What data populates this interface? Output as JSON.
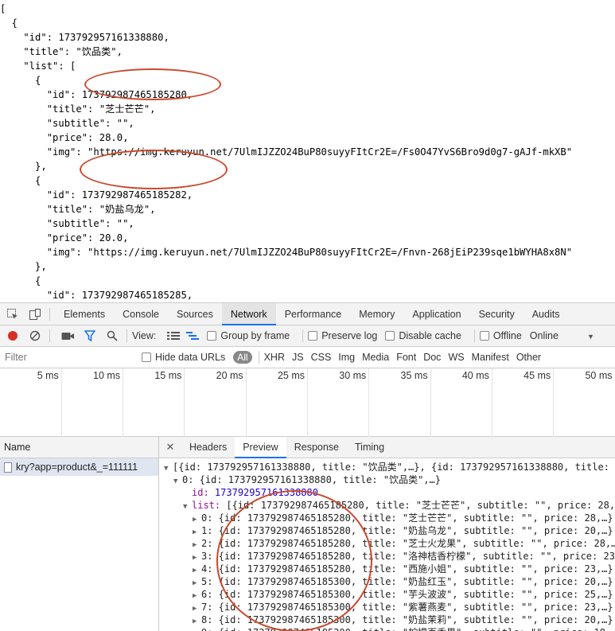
{
  "raw_json_lines": [
    "[",
    "  {",
    "    \"id\": 173792957161338880,",
    "    \"title\": \"饮品类\",",
    "    \"list\": [",
    "      {",
    "        \"id\": 173792987465185280,",
    "        \"title\": \"芝士芒芒\",",
    "        \"subtitle\": \"\",",
    "        \"price\": 28.0,",
    "        \"img\": \"https://img.keruyun.net/7UlmIJZZO24BuP80suyyFItCr2E=/Fs0O47YvS6Bro9d0g7-gAJf-mkXB\"",
    "      },",
    "      {",
    "        \"id\": 173792987465185282,",
    "        \"title\": \"奶盐乌龙\",",
    "        \"subtitle\": \"\",",
    "        \"price\": 20.0,",
    "        \"img\": \"https://img.keruyun.net/7UlmIJZZO24BuP80suyyFItCr2E=/Fnvn-268jEiP239sqe1bWYHA8x8N\"",
    "      },",
    "      {",
    "        \"id\": 173792987465185285,",
    "        \"title\": \"芝士火龙果\",",
    "        \"subtitle\": \"\",",
    "        \"price\": 28.0,"
  ],
  "devtools": {
    "tabs": [
      "Elements",
      "Console",
      "Sources",
      "Network",
      "Performance",
      "Memory",
      "Application",
      "Security",
      "Audits"
    ],
    "active_tab": "Network",
    "toolbar": {
      "view_label": "View:",
      "group_by_frame": "Group by frame",
      "preserve_log": "Preserve log",
      "disable_cache": "Disable cache",
      "offline": "Offline",
      "throttle": "Online"
    },
    "filter": {
      "placeholder": "Filter",
      "hide_data_urls": "Hide data URLs",
      "all": "All",
      "types": [
        "XHR",
        "JS",
        "CSS",
        "Img",
        "Media",
        "Font",
        "Doc",
        "WS",
        "Manifest",
        "Other"
      ]
    },
    "overview_ticks": [
      "5 ms",
      "10 ms",
      "15 ms",
      "20 ms",
      "25 ms",
      "30 ms",
      "35 ms",
      "40 ms",
      "45 ms",
      "50 ms"
    ],
    "name_header": "Name",
    "request_name": "kry?app=product&_=111111",
    "detail_tabs": [
      "Headers",
      "Preview",
      "Response",
      "Timing"
    ],
    "active_detail_tab": "Preview",
    "preview": {
      "root": "[{id: 173792957161338880, title: \"饮品类\",…}, {id: 173792957161338880, title:",
      "item0": "0: {id: 173792957161338880, title: \"饮品类\",…}",
      "id_key": "id:",
      "id_val": "173792957161338880",
      "list_key": "list:",
      "list_val": "[{id: 173792987465185280, title: \"芝士芒芒\", subtitle: \"\", price: 28,",
      "items": [
        "0: {id: 173792987465185280, title: \"芝士芒芒\", subtitle: \"\", price: 28,…}",
        "1: {id: 173792987465185280, title: \"奶盐乌龙\", subtitle: \"\", price: 20,…}",
        "2: {id: 173792987465185280, title: \"芝士火龙果\", subtitle: \"\", price: 28,…",
        "3: {id: 173792987465185280, title: \"洛神桔香柠檬\", subtitle: \"\", price: 23",
        "4: {id: 173792987465185280, title: \"西施小姐\", subtitle: \"\", price: 23,…}",
        "5: {id: 173792987465185300, title: \"奶盐红玉\", subtitle: \"\", price: 20,…}",
        "6: {id: 173792987465185300, title: \"芋头波波\", subtitle: \"\", price: 25,…}",
        "7: {id: 173792987465185300, title: \"紫薯燕麦\", subtitle: \"\", price: 23,…}",
        "8: {id: 173792987465185300, title: \"奶盐茉莉\", subtitle: \"\", price: 20,…}",
        "9: {id: 173792987465185300, title: \"柠檬百香果\", subtitle: \"\", price: 18,…"
      ]
    }
  },
  "colors": {
    "annotation": "#c9492c",
    "accent": "#1a73e8",
    "record": "#d93025"
  }
}
